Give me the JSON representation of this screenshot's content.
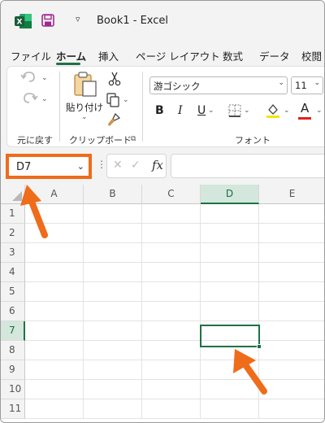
{
  "titlebar": {
    "app_icon": "excel-logo",
    "save_icon": "save-icon",
    "qat_customize": "▿",
    "title": "Book1  -  Excel"
  },
  "tabs": [
    {
      "label": "ファイル",
      "active": false
    },
    {
      "label": "ホーム",
      "active": true
    },
    {
      "label": "挿入",
      "active": false
    },
    {
      "label": "ページ レイアウト",
      "active": false
    },
    {
      "label": "数式",
      "active": false
    },
    {
      "label": "データ",
      "active": false
    },
    {
      "label": "校閲",
      "active": false
    }
  ],
  "ribbon": {
    "undo_group": {
      "label": "元に戻す",
      "undo_icon": "undo-icon",
      "redo_icon": "redo-icon"
    },
    "clipboard_group": {
      "label": "クリップボード",
      "paste_label": "貼り付け",
      "cut_icon": "scissors-icon",
      "copy_icon": "copy-icon",
      "format_painter_icon": "brush-icon"
    },
    "font_group": {
      "label": "フォント",
      "font_name": "游ゴシック",
      "font_size": "11",
      "bold": "B",
      "italic": "I",
      "underline": "U",
      "font_color_letter": "A",
      "fill_color": "#f2e600",
      "font_color": "#e0201c"
    }
  },
  "formula_bar": {
    "name_box": "D7",
    "name_box_highlight": "#ef6c1a",
    "dots": "⋮",
    "cancel_icon": "✕",
    "enter_icon": "✓",
    "fx": "fx",
    "content": ""
  },
  "grid": {
    "columns": [
      "A",
      "B",
      "C",
      "D",
      "E"
    ],
    "rows": [
      "1",
      "2",
      "3",
      "4",
      "5",
      "6",
      "7",
      "8",
      "9",
      "10",
      "11"
    ],
    "selected_column": "D",
    "selected_row": "7",
    "accent": "#1e7145"
  },
  "annotations": {
    "arrow_color": "#ef6c1a"
  }
}
